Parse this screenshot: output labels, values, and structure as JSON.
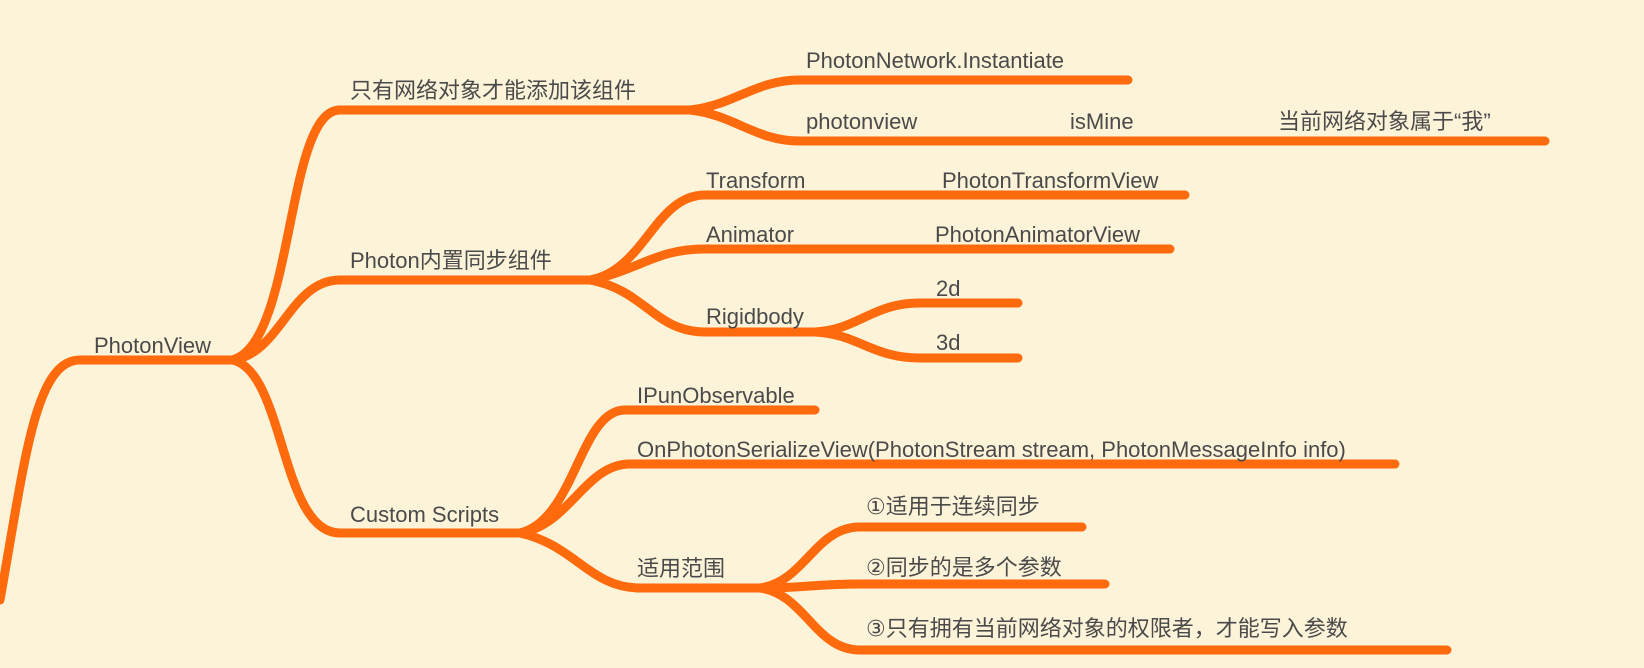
{
  "colors": {
    "background": "#fdf3d9",
    "branch": "#ff6a0c",
    "text": "#4a4a4a"
  },
  "root": {
    "label": "PhotonView"
  },
  "branches": {
    "network_only": {
      "label": "只有网络对象才能添加该组件",
      "instantiate": "PhotonNetwork.Instantiate",
      "photonview": "photonview",
      "ismine": "isMine",
      "belongs": "当前网络对象属于“我”"
    },
    "builtin": {
      "label": "Photon内置同步组件",
      "transform": "Transform",
      "transform_view": "PhotonTransformView",
      "animator": "Animator",
      "animator_view": "PhotonAnimatorView",
      "rigidbody": "Rigidbody",
      "rb_2d": "2d",
      "rb_3d": "3d"
    },
    "custom": {
      "label": "Custom Scripts",
      "ipun": "IPunObservable",
      "serialize": "OnPhotonSerializeView(PhotonStream stream, PhotonMessageInfo info)",
      "scope": "适用范围",
      "scope_1": "①适用于连续同步",
      "scope_2": "②同步的是多个参数",
      "scope_3": "③只有拥有当前网络对象的权限者，才能写入参数"
    }
  }
}
